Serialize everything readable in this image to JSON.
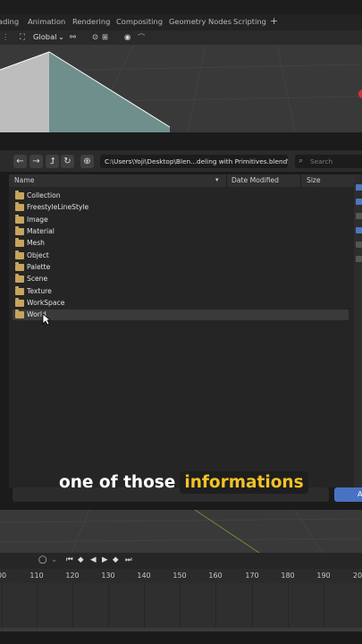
{
  "workspace_tabs": [
    "ading",
    "Animation",
    "Rendering",
    "Compositing",
    "Geometry Nodes",
    "Scripting"
  ],
  "viewport_header": {
    "orientation_label": "Global"
  },
  "file_browser": {
    "path": "C:\\Users\\Yoji\\Desktop\\Blen...deling with Primitives.blend\\",
    "search_placeholder": "Search",
    "columns": {
      "name": "Name",
      "date": "Date Modified",
      "size": "Size"
    },
    "folders": [
      "Collection",
      "FreestyleLineStyle",
      "Image",
      "Material",
      "Mesh",
      "Object",
      "Palette",
      "Scene",
      "Texture",
      "WorkSpace",
      "World"
    ],
    "hovered_folder": "World",
    "confirm_label": "A"
  },
  "caption": {
    "text": "one of those",
    "highlight": "informations"
  },
  "timeline": {
    "frame_ticks": [
      "00",
      "110",
      "120",
      "130",
      "140",
      "150",
      "160",
      "170",
      "180",
      "190",
      "20"
    ]
  },
  "colors": {
    "accent_blue": "#4773c2",
    "folder": "#c7a55e",
    "caption_highlight": "#f3c227"
  }
}
